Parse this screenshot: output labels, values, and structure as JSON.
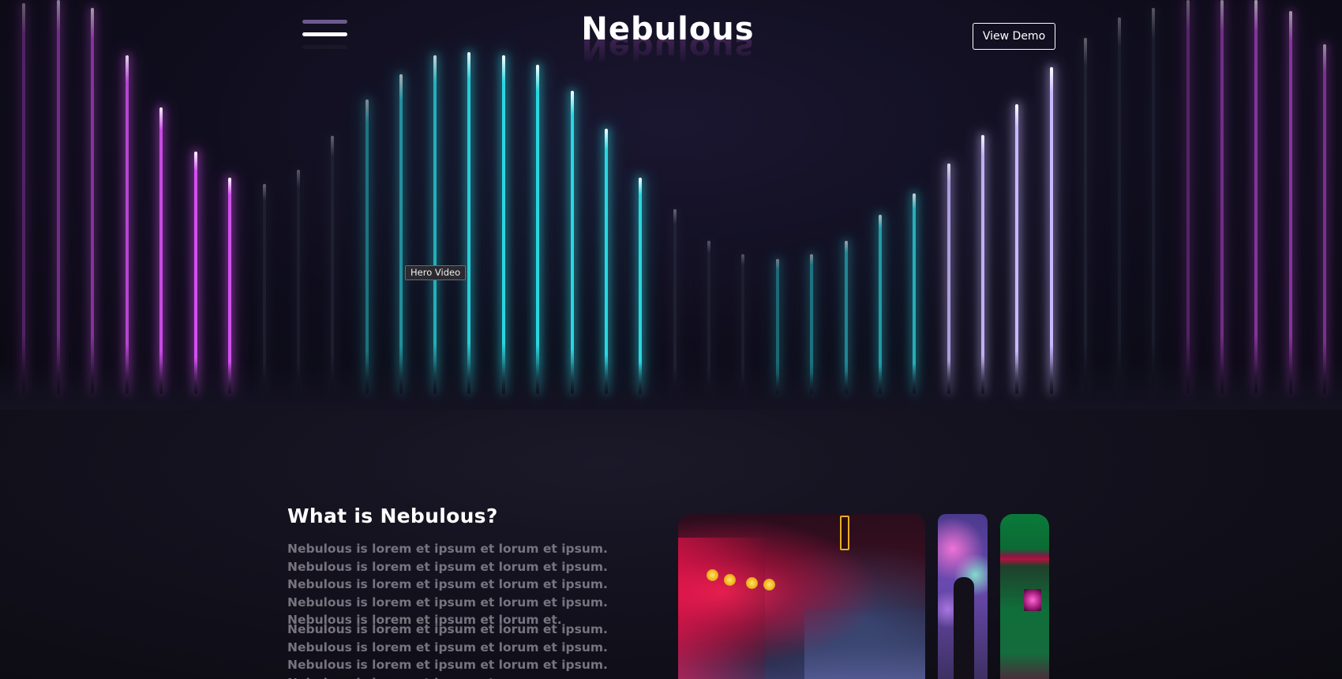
{
  "header": {
    "logo_text": "Nebulous",
    "demo_button_label": "View Demo"
  },
  "hero": {
    "video_label": "Hero Video"
  },
  "about": {
    "title": "What is Nebulous?",
    "paragraphs": [
      "Nebulous is lorem et ipsum et lorum et ipsum. Nebulous is lorem et ipsum et lorum et ipsum. Nebulous is lorem et ipsum et lorum et ipsum. Nebulous is lorem et ipsum et lorum et ipsum. Nebulous is lorem et ipsum et lorum et.",
      "Nebulous is lorem et ipsum et lorum et ipsum. Nebulous is lorem et ipsum et lorum et ipsum. Nebulous is lorem et ipsum et lorum et ipsum. Nebulous is lorem et ipsum et"
    ]
  },
  "colors": {
    "magenta": "#d34ff0",
    "cyan": "#2ad6e0",
    "violet": "#c9b8ff",
    "background": "#0b0a12"
  },
  "icons": {
    "menu": "hamburger-menu-icon"
  }
}
